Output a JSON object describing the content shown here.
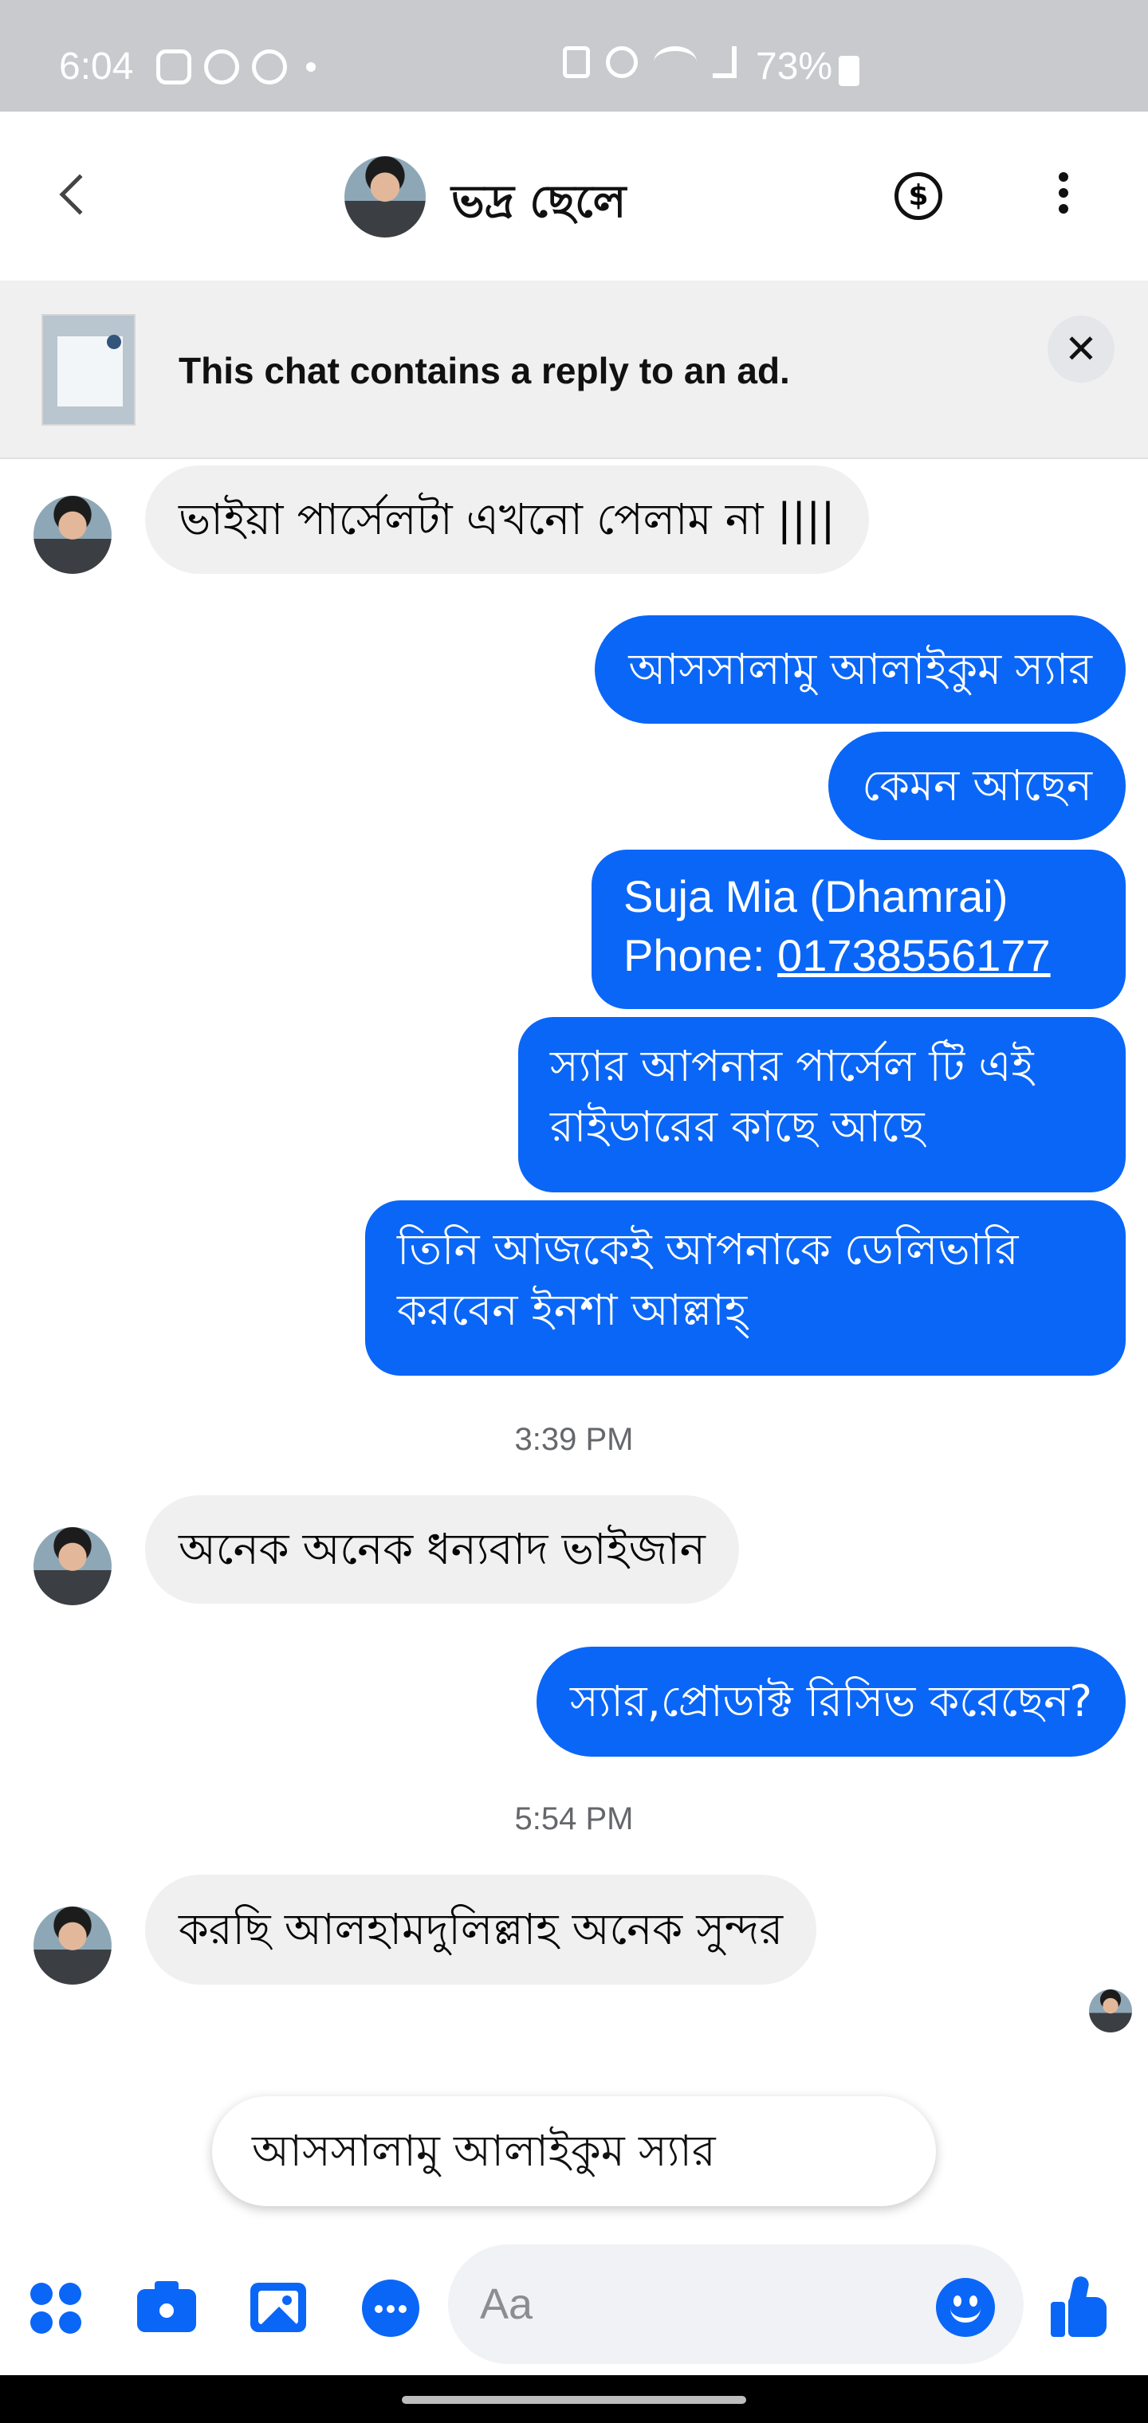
{
  "status_bar": {
    "time": "6:04",
    "battery": "73%"
  },
  "header": {
    "contact_name": "ভদ্র ছেলে"
  },
  "ad_banner": {
    "text": "This chat contains a reply to an ad.",
    "close_symbol": "✕"
  },
  "messages": [
    {
      "from": "contact",
      "text": "ভাইয়া পার্সেলটা এখনো পেলাম না ||||"
    },
    {
      "from": "me",
      "text": "আসসালামু আলাইকুম স্যার"
    },
    {
      "from": "me",
      "text": "কেমন আছেন"
    },
    {
      "from": "me",
      "line1": "Suja Mia (Dhamrai)",
      "phone_label": "Phone: ",
      "phone": "01738556177"
    },
    {
      "from": "me",
      "text": "স্যার আপনার পার্সেল টি এই রাইডারের কাছে আছে"
    },
    {
      "from": "me",
      "text": "তিনি আজকেই আপনাকে ডেলিভারি করবেন ইনশা আল্লাহ্"
    },
    {
      "from": "contact",
      "text": "অনেক অনেক ধন্যবাদ ভাইজান"
    },
    {
      "from": "me",
      "text": "স্যার,প্রোডাক্ট রিসিভ করেছেন?"
    },
    {
      "from": "contact",
      "text": "করছি আলহামদুলিল্লাহ অনেক সুন্দর"
    }
  ],
  "timestamps": [
    "3:39 PM",
    "5:54 PM"
  ],
  "quick_reply": "আসসালামু আলাইকুম স্যার",
  "composer": {
    "placeholder": "Aa"
  },
  "colors": {
    "accent": "#0a66f7",
    "incoming_bubble": "#f0f0f0",
    "status_bar": "#c9cacd"
  }
}
